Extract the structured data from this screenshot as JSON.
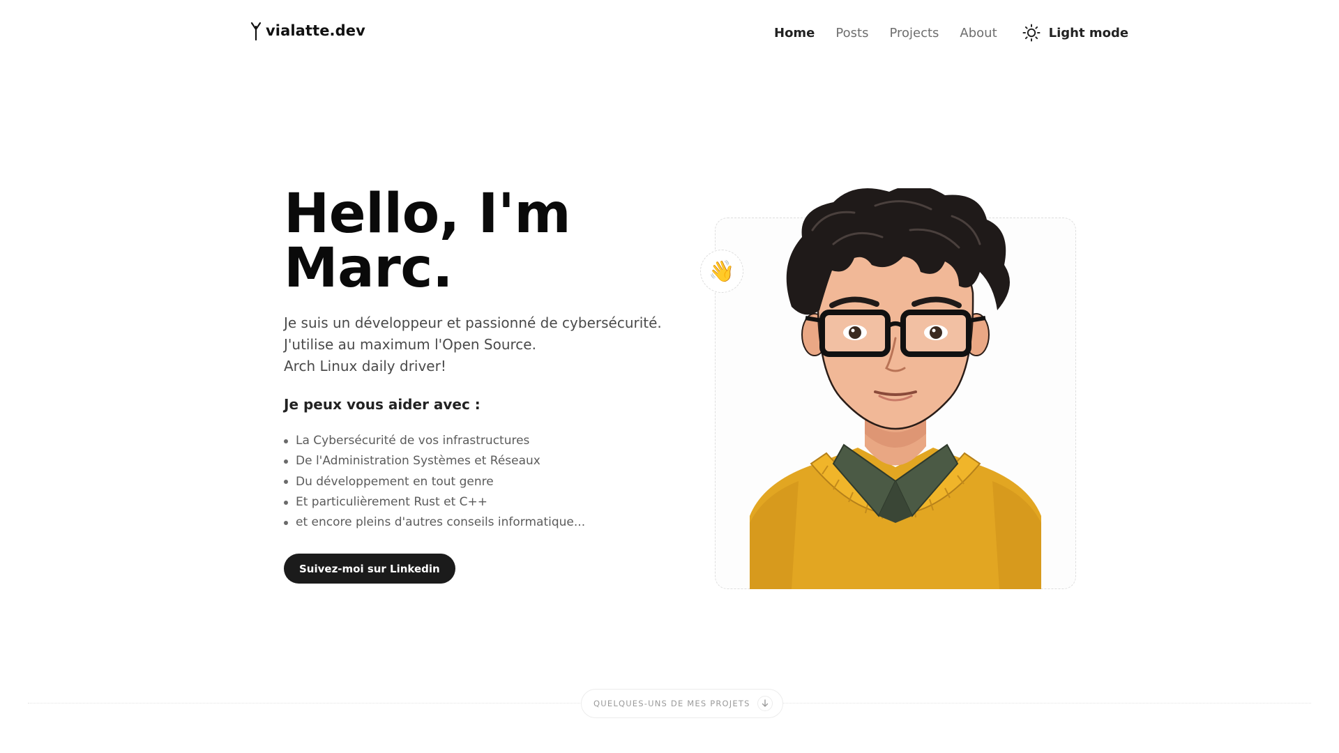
{
  "header": {
    "logo_text": "vialatte.dev",
    "nav": [
      {
        "label": "Home",
        "active": true
      },
      {
        "label": "Posts",
        "active": false
      },
      {
        "label": "Projects",
        "active": false
      },
      {
        "label": "About",
        "active": false
      }
    ],
    "theme_toggle_label": "Light mode",
    "theme_icon": "sun-icon"
  },
  "hero": {
    "title_line1": "Hello, I'm",
    "title_line2": "Marc.",
    "intro": [
      "Je suis un développeur et passionné de cybersécurité.",
      "J'utilise au maximum l'Open Source.",
      "Arch Linux daily driver!"
    ],
    "help_title": "Je peux vous aider avec :",
    "help_items": [
      "La Cybersécurité de vos infrastructures",
      "De l'Administration Systèmes et Réseaux",
      "Du développement en tout genre",
      "Et particulièrement Rust et C++",
      "et encore pleins d'autres conseils informatique..."
    ],
    "cta_label": "Suivez-moi sur Linkedin",
    "wave_emoji": "👋"
  },
  "projects_divider": {
    "label": "QUELQUES-UNS DE MES PROJETS",
    "icon": "arrow-down-icon"
  },
  "colors": {
    "text": "#0a0a0a",
    "muted": "#5b5b5b",
    "button_bg": "#1b1b1b",
    "sweater": "#e2a622",
    "collar": "#4b5a45",
    "hair": "#1f1a19",
    "skin": "#f1b897"
  }
}
